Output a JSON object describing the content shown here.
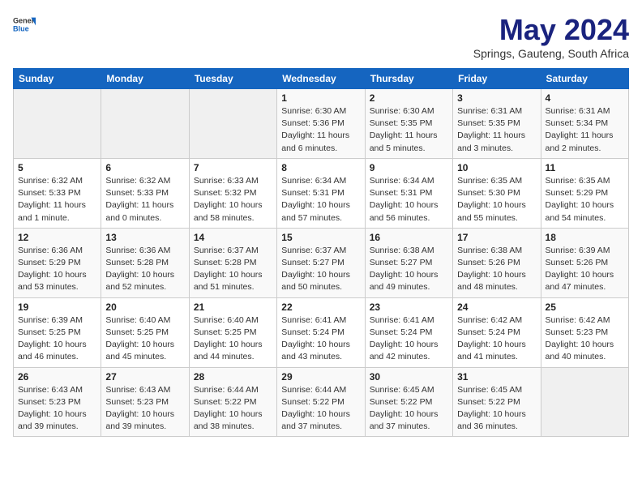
{
  "header": {
    "logo_general": "General",
    "logo_blue": "Blue",
    "title": "May 2024",
    "subtitle": "Springs, Gauteng, South Africa"
  },
  "calendar": {
    "days_of_week": [
      "Sunday",
      "Monday",
      "Tuesday",
      "Wednesday",
      "Thursday",
      "Friday",
      "Saturday"
    ],
    "weeks": [
      [
        {
          "day": "",
          "info": ""
        },
        {
          "day": "",
          "info": ""
        },
        {
          "day": "",
          "info": ""
        },
        {
          "day": "1",
          "info": "Sunrise: 6:30 AM\nSunset: 5:36 PM\nDaylight: 11 hours\nand 6 minutes."
        },
        {
          "day": "2",
          "info": "Sunrise: 6:30 AM\nSunset: 5:35 PM\nDaylight: 11 hours\nand 5 minutes."
        },
        {
          "day": "3",
          "info": "Sunrise: 6:31 AM\nSunset: 5:35 PM\nDaylight: 11 hours\nand 3 minutes."
        },
        {
          "day": "4",
          "info": "Sunrise: 6:31 AM\nSunset: 5:34 PM\nDaylight: 11 hours\nand 2 minutes."
        }
      ],
      [
        {
          "day": "5",
          "info": "Sunrise: 6:32 AM\nSunset: 5:33 PM\nDaylight: 11 hours\nand 1 minute."
        },
        {
          "day": "6",
          "info": "Sunrise: 6:32 AM\nSunset: 5:33 PM\nDaylight: 11 hours\nand 0 minutes."
        },
        {
          "day": "7",
          "info": "Sunrise: 6:33 AM\nSunset: 5:32 PM\nDaylight: 10 hours\nand 58 minutes."
        },
        {
          "day": "8",
          "info": "Sunrise: 6:34 AM\nSunset: 5:31 PM\nDaylight: 10 hours\nand 57 minutes."
        },
        {
          "day": "9",
          "info": "Sunrise: 6:34 AM\nSunset: 5:31 PM\nDaylight: 10 hours\nand 56 minutes."
        },
        {
          "day": "10",
          "info": "Sunrise: 6:35 AM\nSunset: 5:30 PM\nDaylight: 10 hours\nand 55 minutes."
        },
        {
          "day": "11",
          "info": "Sunrise: 6:35 AM\nSunset: 5:29 PM\nDaylight: 10 hours\nand 54 minutes."
        }
      ],
      [
        {
          "day": "12",
          "info": "Sunrise: 6:36 AM\nSunset: 5:29 PM\nDaylight: 10 hours\nand 53 minutes."
        },
        {
          "day": "13",
          "info": "Sunrise: 6:36 AM\nSunset: 5:28 PM\nDaylight: 10 hours\nand 52 minutes."
        },
        {
          "day": "14",
          "info": "Sunrise: 6:37 AM\nSunset: 5:28 PM\nDaylight: 10 hours\nand 51 minutes."
        },
        {
          "day": "15",
          "info": "Sunrise: 6:37 AM\nSunset: 5:27 PM\nDaylight: 10 hours\nand 50 minutes."
        },
        {
          "day": "16",
          "info": "Sunrise: 6:38 AM\nSunset: 5:27 PM\nDaylight: 10 hours\nand 49 minutes."
        },
        {
          "day": "17",
          "info": "Sunrise: 6:38 AM\nSunset: 5:26 PM\nDaylight: 10 hours\nand 48 minutes."
        },
        {
          "day": "18",
          "info": "Sunrise: 6:39 AM\nSunset: 5:26 PM\nDaylight: 10 hours\nand 47 minutes."
        }
      ],
      [
        {
          "day": "19",
          "info": "Sunrise: 6:39 AM\nSunset: 5:25 PM\nDaylight: 10 hours\nand 46 minutes."
        },
        {
          "day": "20",
          "info": "Sunrise: 6:40 AM\nSunset: 5:25 PM\nDaylight: 10 hours\nand 45 minutes."
        },
        {
          "day": "21",
          "info": "Sunrise: 6:40 AM\nSunset: 5:25 PM\nDaylight: 10 hours\nand 44 minutes."
        },
        {
          "day": "22",
          "info": "Sunrise: 6:41 AM\nSunset: 5:24 PM\nDaylight: 10 hours\nand 43 minutes."
        },
        {
          "day": "23",
          "info": "Sunrise: 6:41 AM\nSunset: 5:24 PM\nDaylight: 10 hours\nand 42 minutes."
        },
        {
          "day": "24",
          "info": "Sunrise: 6:42 AM\nSunset: 5:24 PM\nDaylight: 10 hours\nand 41 minutes."
        },
        {
          "day": "25",
          "info": "Sunrise: 6:42 AM\nSunset: 5:23 PM\nDaylight: 10 hours\nand 40 minutes."
        }
      ],
      [
        {
          "day": "26",
          "info": "Sunrise: 6:43 AM\nSunset: 5:23 PM\nDaylight: 10 hours\nand 39 minutes."
        },
        {
          "day": "27",
          "info": "Sunrise: 6:43 AM\nSunset: 5:23 PM\nDaylight: 10 hours\nand 39 minutes."
        },
        {
          "day": "28",
          "info": "Sunrise: 6:44 AM\nSunset: 5:22 PM\nDaylight: 10 hours\nand 38 minutes."
        },
        {
          "day": "29",
          "info": "Sunrise: 6:44 AM\nSunset: 5:22 PM\nDaylight: 10 hours\nand 37 minutes."
        },
        {
          "day": "30",
          "info": "Sunrise: 6:45 AM\nSunset: 5:22 PM\nDaylight: 10 hours\nand 37 minutes."
        },
        {
          "day": "31",
          "info": "Sunrise: 6:45 AM\nSunset: 5:22 PM\nDaylight: 10 hours\nand 36 minutes."
        },
        {
          "day": "",
          "info": ""
        }
      ]
    ]
  }
}
